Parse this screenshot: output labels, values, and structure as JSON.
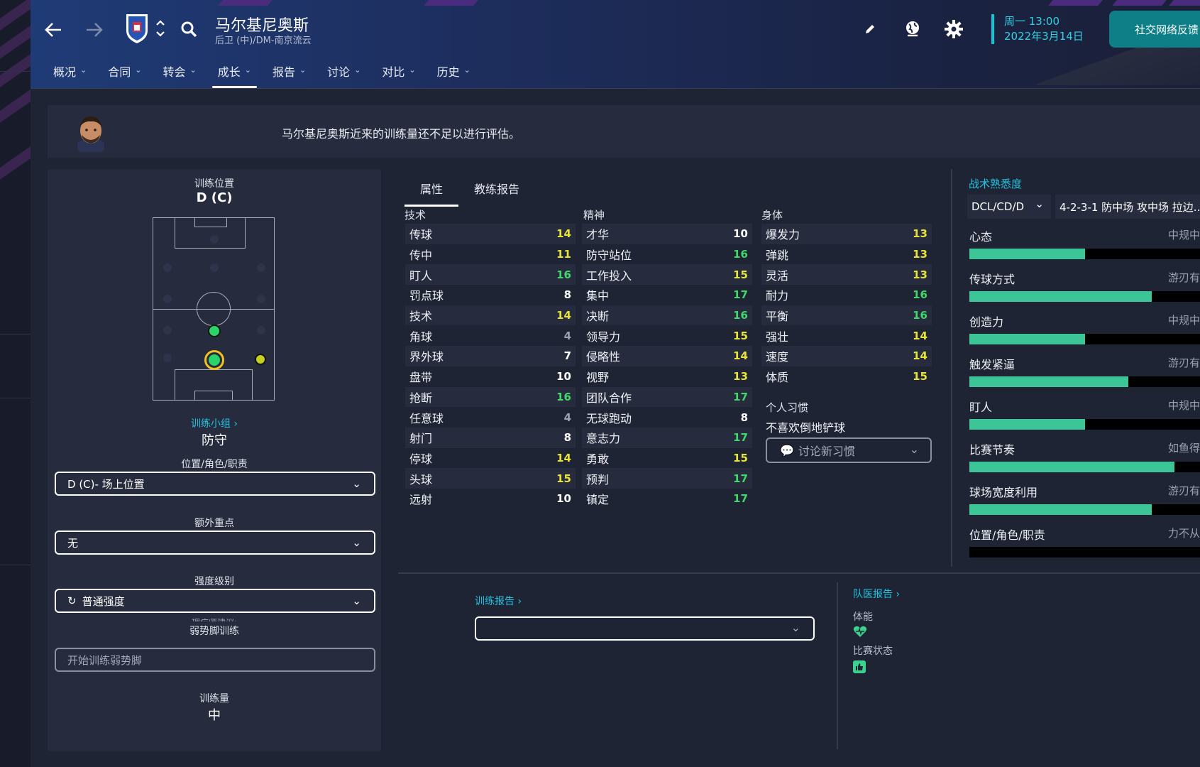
{
  "header": {
    "player_name": "马尔基尼奥斯",
    "player_sub": "后卫 (中)/DM-南京流云",
    "date_day": "周一 13:00",
    "date_full": "2022年3月14日",
    "feedback_label": "社交网络反馈"
  },
  "nav": [
    {
      "label": "概况",
      "active": false
    },
    {
      "label": "合同",
      "active": false
    },
    {
      "label": "转会",
      "active": false
    },
    {
      "label": "成长",
      "active": true
    },
    {
      "label": "报告",
      "active": false
    },
    {
      "label": "讨论",
      "active": false
    },
    {
      "label": "对比",
      "active": false
    },
    {
      "label": "历史",
      "active": false
    }
  ],
  "banner": {
    "text": "马尔基尼奥斯近来的训练量还不足以进行评估。"
  },
  "training": {
    "position_label": "训练位置",
    "position_value": "D (C)",
    "group_link": "训练小组",
    "group_value": "防守",
    "role_label": "位置/角色/职责",
    "role_value": "D (C)- 场上位置",
    "extra_label": "额外重点",
    "extra_value": "无",
    "intensity_label": "强度级别",
    "intensity_value": "普通强度",
    "coach_hint": "理疗师建议:",
    "weakfoot_label": "弱势脚训练",
    "weakfoot_placeholder": "开始训练弱势脚",
    "load_label": "训练量",
    "load_value": "中"
  },
  "tabs": [
    "属性",
    "教练报告"
  ],
  "attributes": {
    "technical": {
      "title": "技术",
      "items": [
        {
          "name": "传球",
          "value": "14"
        },
        {
          "name": "传中",
          "value": "11"
        },
        {
          "name": "盯人",
          "value": "16"
        },
        {
          "name": "罚点球",
          "value": "8"
        },
        {
          "name": "技术",
          "value": "14"
        },
        {
          "name": "角球",
          "value": "4"
        },
        {
          "name": "界外球",
          "value": "7"
        },
        {
          "name": "盘带",
          "value": "10"
        },
        {
          "name": "抢断",
          "value": "16"
        },
        {
          "name": "任意球",
          "value": "4"
        },
        {
          "name": "射门",
          "value": "8"
        },
        {
          "name": "停球",
          "value": "14"
        },
        {
          "name": "头球",
          "value": "15"
        },
        {
          "name": "远射",
          "value": "10"
        }
      ]
    },
    "mental": {
      "title": "精神",
      "items": [
        {
          "name": "才华",
          "value": "10"
        },
        {
          "name": "防守站位",
          "value": "16"
        },
        {
          "name": "工作投入",
          "value": "15"
        },
        {
          "name": "集中",
          "value": "17"
        },
        {
          "name": "决断",
          "value": "16"
        },
        {
          "name": "领导力",
          "value": "15"
        },
        {
          "name": "侵略性",
          "value": "14"
        },
        {
          "name": "视野",
          "value": "13"
        },
        {
          "name": "团队合作",
          "value": "17"
        },
        {
          "name": "无球跑动",
          "value": "8"
        },
        {
          "name": "意志力",
          "value": "17"
        },
        {
          "name": "勇敢",
          "value": "15"
        },
        {
          "name": "预判",
          "value": "17"
        },
        {
          "name": "镇定",
          "value": "17"
        }
      ]
    },
    "physical": {
      "title": "身体",
      "items": [
        {
          "name": "爆发力",
          "value": "13"
        },
        {
          "name": "弹跳",
          "value": "13"
        },
        {
          "name": "灵活",
          "value": "13"
        },
        {
          "name": "耐力",
          "value": "16"
        },
        {
          "name": "平衡",
          "value": "16"
        },
        {
          "name": "强壮",
          "value": "14"
        },
        {
          "name": "速度",
          "value": "14"
        },
        {
          "name": "体质",
          "value": "15"
        }
      ]
    }
  },
  "habits": {
    "title": "个人习惯",
    "value": "不喜欢倒地铲球",
    "button": "讨论新习惯"
  },
  "tactics": {
    "title": "战术熟悉度",
    "position_select": "DCL/CD/D",
    "formation_select": "4-2-3-1 防中场 攻中场 拉边...",
    "items": [
      {
        "name": "心态",
        "level": "中规中",
        "fill": 0.5
      },
      {
        "name": "传球方式",
        "level": "游刃有",
        "fill": 0.79
      },
      {
        "name": "创造力",
        "level": "中规中",
        "fill": 0.5
      },
      {
        "name": "触发紧逼",
        "level": "游刃有",
        "fill": 0.69
      },
      {
        "name": "盯人",
        "level": "中规中",
        "fill": 0.5
      },
      {
        "name": "比赛节奏",
        "level": "如鱼得",
        "fill": 0.89
      },
      {
        "name": "球场宽度利用",
        "level": "游刃有",
        "fill": 0.79
      },
      {
        "name": "位置/角色/职责",
        "level": "力不从",
        "fill": 0.0
      }
    ]
  },
  "training_report": {
    "link": "训练报告"
  },
  "medical": {
    "link": "队医报告",
    "fitness_label": "体能",
    "form_label": "比赛状态"
  },
  "colors": {
    "accent": "#22c3e0",
    "green": "#3cc596",
    "value_green": "#41d96a",
    "value_yellow": "#e8e437",
    "value_white": "#ffffff",
    "value_grey": "#9ca1b0"
  }
}
